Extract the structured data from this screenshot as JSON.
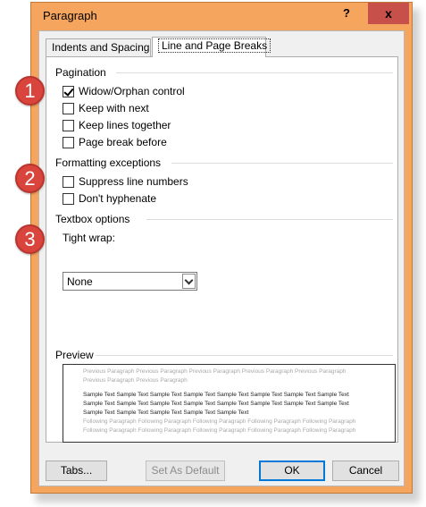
{
  "window": {
    "title": "Paragraph",
    "help_label": "?",
    "close_label": "x"
  },
  "tabs": [
    {
      "label": "Indents and Spacing",
      "active": false
    },
    {
      "label": "Line and Page Breaks",
      "active": true
    }
  ],
  "pagination": {
    "heading": "Pagination",
    "options": [
      {
        "label": "Widow/Orphan control",
        "checked": true
      },
      {
        "label": "Keep with next",
        "checked": false
      },
      {
        "label": "Keep lines together",
        "checked": false
      },
      {
        "label": "Page break before",
        "checked": false
      }
    ]
  },
  "formatting_exceptions": {
    "heading": "Formatting exceptions",
    "options": [
      {
        "label": "Suppress line numbers",
        "checked": false
      },
      {
        "label": "Don't hyphenate",
        "checked": false
      }
    ]
  },
  "textbox_options": {
    "heading": "Textbox options",
    "tight_wrap_label": "Tight wrap:",
    "tight_wrap_value": "None"
  },
  "preview": {
    "heading": "Preview",
    "previous_lines": [
      "Previous Paragraph Previous Paragraph Previous Paragraph Previous Paragraph Previous Paragraph",
      "Previous Paragraph Previous Paragraph"
    ],
    "sample_lines": [
      "Sample Text Sample Text Sample Text Sample Text Sample Text Sample Text Sample Text Sample Text",
      "Sample Text Sample Text Sample Text Sample Text Sample Text Sample Text Sample Text Sample Text",
      "Sample Text Sample Text Sample Text Sample Text Sample Text"
    ],
    "following_lines": [
      "Following Paragraph Following Paragraph Following Paragraph Following Paragraph Following Paragraph",
      "Following Paragraph Following Paragraph Following Paragraph Following Paragraph Following Paragraph"
    ]
  },
  "buttons": {
    "tabs": "Tabs...",
    "set_default": "Set As Default",
    "ok": "OK",
    "cancel": "Cancel"
  },
  "callouts": [
    "1",
    "2",
    "3"
  ],
  "colors": {
    "window_frame": "#f5a55e",
    "close_button": "#c7504a",
    "callout_badge": "#d9443c"
  }
}
